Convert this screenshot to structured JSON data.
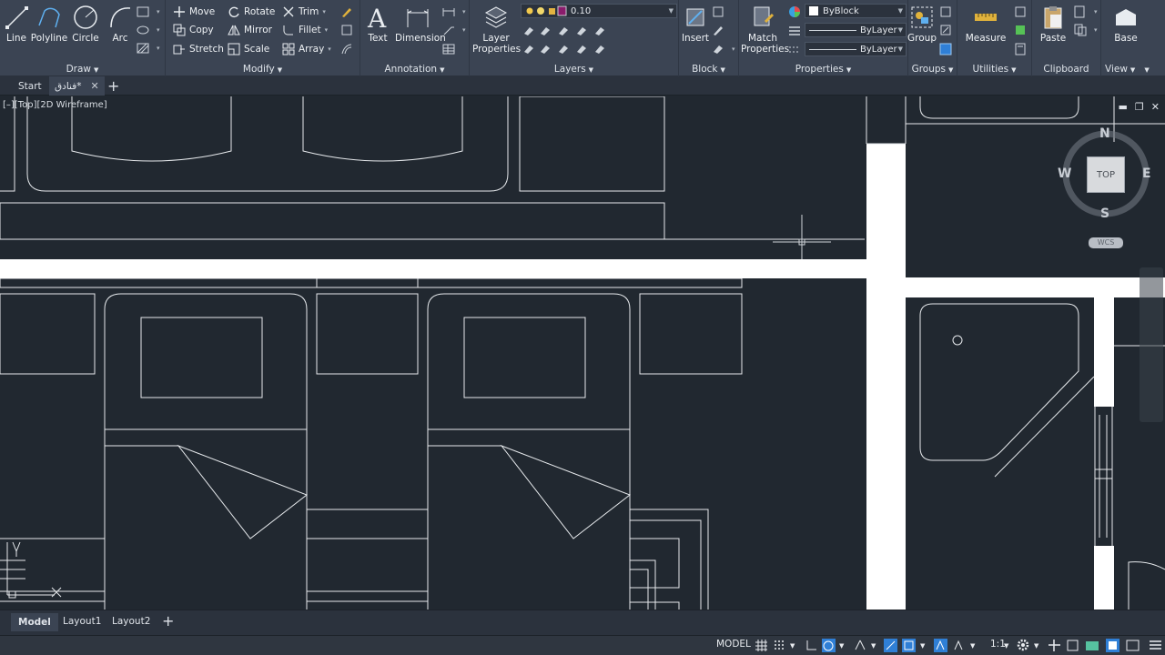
{
  "ribbon": {
    "draw": {
      "title": "Draw",
      "line": "Line",
      "polyline": "Polyline",
      "circle": "Circle",
      "arc": "Arc"
    },
    "modify": {
      "title": "Modify",
      "move": "Move",
      "rotate": "Rotate",
      "trim": "Trim",
      "copy": "Copy",
      "mirror": "Mirror",
      "fillet": "Fillet",
      "stretch": "Stretch",
      "scale": "Scale",
      "array": "Array"
    },
    "annotation": {
      "title": "Annotation",
      "text": "Text",
      "dimension": "Dimension"
    },
    "layers": {
      "title": "Layers",
      "layer_properties": "Layer Properties",
      "current_layer": "0.10",
      "layer_color": "#8a1c6c"
    },
    "block": {
      "title": "Block",
      "insert": "Insert"
    },
    "properties": {
      "title": "Properties",
      "match": "Match Properties",
      "color": "ByBlock",
      "linetype": "ByLayer",
      "lineweight": "ByLayer"
    },
    "groups": {
      "title": "Groups",
      "group": "Group"
    },
    "utilities": {
      "title": "Utilities",
      "measure": "Measure"
    },
    "clipboard": {
      "title": "Clipboard",
      "paste": "Paste"
    },
    "view": {
      "title": "View",
      "base": "Base"
    }
  },
  "file_tabs": {
    "start": "Start",
    "drawing": "فنادق*"
  },
  "viewport": {
    "label": "[–][Top][2D Wireframe]"
  },
  "viewcube": {
    "north": "N",
    "south": "S",
    "east": "E",
    "west": "W",
    "face": "TOP",
    "wcs": "WCS"
  },
  "layout_tabs": [
    "Model",
    "Layout1",
    "Layout2"
  ],
  "status": {
    "mode": "MODEL",
    "scale": "1:1"
  },
  "colors": {
    "background": "#212830",
    "ribbon": "#3b4453",
    "accent": "#2f7fd6"
  }
}
